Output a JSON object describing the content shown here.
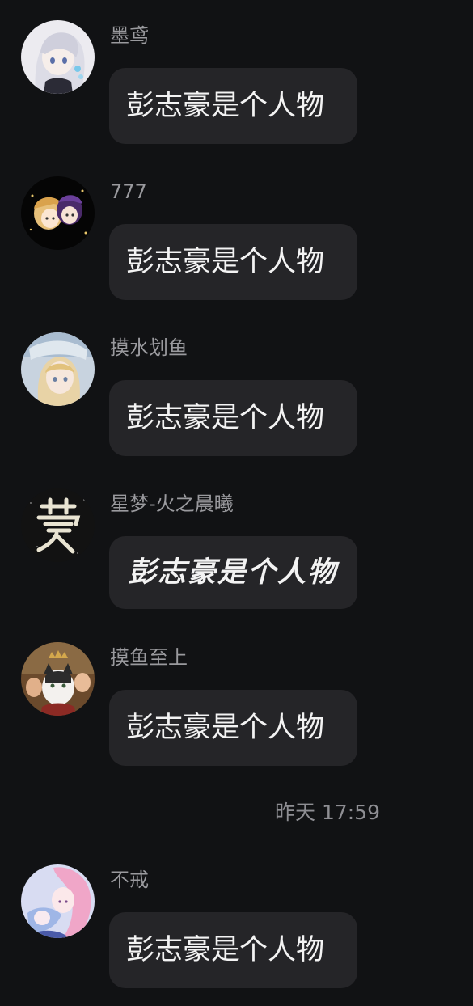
{
  "messages_before": [
    {
      "sender": "墨鸢",
      "text": "彭志豪是个人物",
      "avatar_icon": "anime-girl-white-hair-avatar-icon"
    },
    {
      "sender": "777",
      "text": "彭志豪是个人物",
      "avatar_icon": "chibi-characters-avatar-icon"
    },
    {
      "sender": "摸水划鱼",
      "text": "彭志豪是个人物",
      "avatar_icon": "anime-girl-blonde-avatar-icon"
    },
    {
      "sender": "星梦-火之晨曦",
      "text": "彭志豪是个人物",
      "avatar_icon": "calligraphy-meng-avatar-icon"
    },
    {
      "sender": "摸鱼至上",
      "text": "彭志豪是个人物",
      "avatar_icon": "crowned-cat-painting-avatar-icon"
    }
  ],
  "timestamp": "昨天 17:59",
  "messages_after": [
    {
      "sender": "不戒",
      "text": "彭志豪是个人物",
      "avatar_icon": "anime-pink-hair-avatar-icon"
    }
  ],
  "colors": {
    "background": "#111214",
    "bubble": "#252528",
    "sender_name": "#9a9a9e",
    "message_text": "#f3f3f3",
    "timestamp": "#8e8e93"
  }
}
